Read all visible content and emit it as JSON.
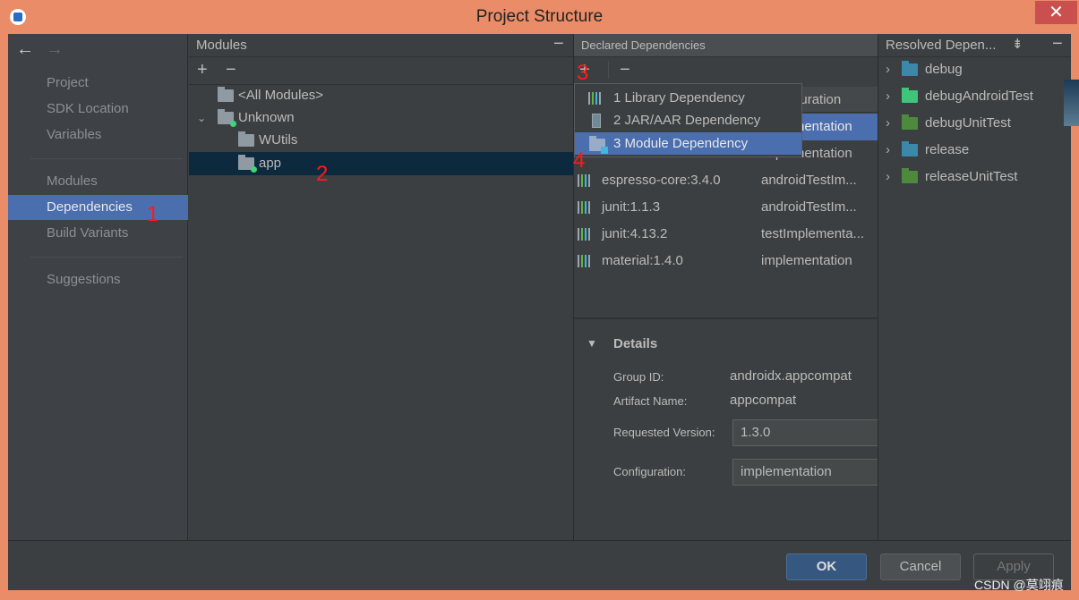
{
  "window": {
    "title": "Project Structure",
    "close": "✕"
  },
  "sidebar": {
    "items": [
      "Project",
      "SDK Location",
      "Variables",
      "Modules",
      "Dependencies",
      "Build Variants",
      "Suggestions"
    ],
    "back": "←",
    "forward": "→"
  },
  "modules": {
    "title": "Modules",
    "add": "+",
    "remove": "−",
    "minimize": "−",
    "tree": [
      "<All Modules>",
      "Unknown",
      "WUtils",
      "app"
    ]
  },
  "declared": {
    "title": "Declared Dependencies",
    "add": "+",
    "remove": "−",
    "config_header": "Configuration",
    "rows": [
      {
        "name": "",
        "config": "implementation"
      },
      {
        "name": "",
        "config": "implementation"
      },
      {
        "name": "espresso-core:3.4.0",
        "config": "androidTestIm..."
      },
      {
        "name": "junit:1.1.3",
        "config": "androidTestIm..."
      },
      {
        "name": "junit:4.13.2",
        "config": "testImplementa..."
      },
      {
        "name": "material:1.4.0",
        "config": "implementation"
      }
    ]
  },
  "popup": {
    "items": [
      "1  Library Dependency",
      "2  JAR/AAR Dependency",
      "3  Module Dependency"
    ]
  },
  "details": {
    "title": "Details",
    "group_label": "Group ID:",
    "group": "androidx.appcompat",
    "artifact_label": "Artifact Name:",
    "artifact": "appcompat",
    "version_label": "Requested Version:",
    "version": "1.3.0",
    "config_label": "Configuration:",
    "config": "implementation"
  },
  "resolved": {
    "title": "Resolved Depen...",
    "items": [
      {
        "label": "debug",
        "color": "#3592c4"
      },
      {
        "label": "debugAndroidTest",
        "color": "#3fc57a"
      },
      {
        "label": "debugUnitTest",
        "color": "#4e8a3e"
      },
      {
        "label": "release",
        "color": "#3592c4"
      },
      {
        "label": "releaseUnitTest",
        "color": "#4e8a3e"
      }
    ]
  },
  "buttons": {
    "ok": "OK",
    "cancel": "Cancel",
    "apply": "Apply"
  },
  "annotations": [
    "1",
    "2",
    "3",
    "4"
  ],
  "watermark": "CSDN @莫翊痕",
  "colors": {
    "selection": "#4b6eaf",
    "frame": "#e98c67",
    "annotation": "#ff1a1a"
  }
}
